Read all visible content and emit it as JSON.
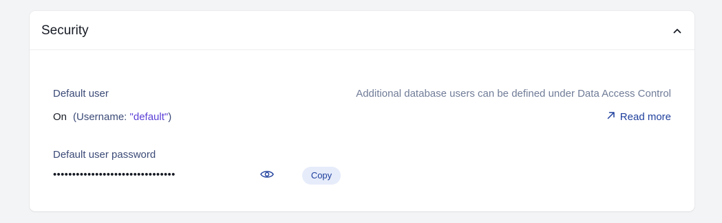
{
  "section": {
    "title": "Security"
  },
  "default_user": {
    "label": "Default user",
    "status": "On",
    "username_prefix": "(Username: ",
    "username_value": "\"default\"",
    "username_suffix": ")"
  },
  "info": {
    "text": "Additional database users can be defined under Data Access Control",
    "read_more_label": "Read more"
  },
  "password": {
    "label": "Default user password",
    "masked_value": "••••••••••••••••••••••••••••••••",
    "copy_label": "Copy"
  },
  "icons": {
    "collapse": "chevron-up-icon",
    "external_link": "arrow-up-right-icon",
    "reveal": "eye-icon"
  },
  "colors": {
    "accent": "#1d3e9c",
    "username": "#5b3fd6",
    "copy_bg": "#e6ecfa"
  }
}
